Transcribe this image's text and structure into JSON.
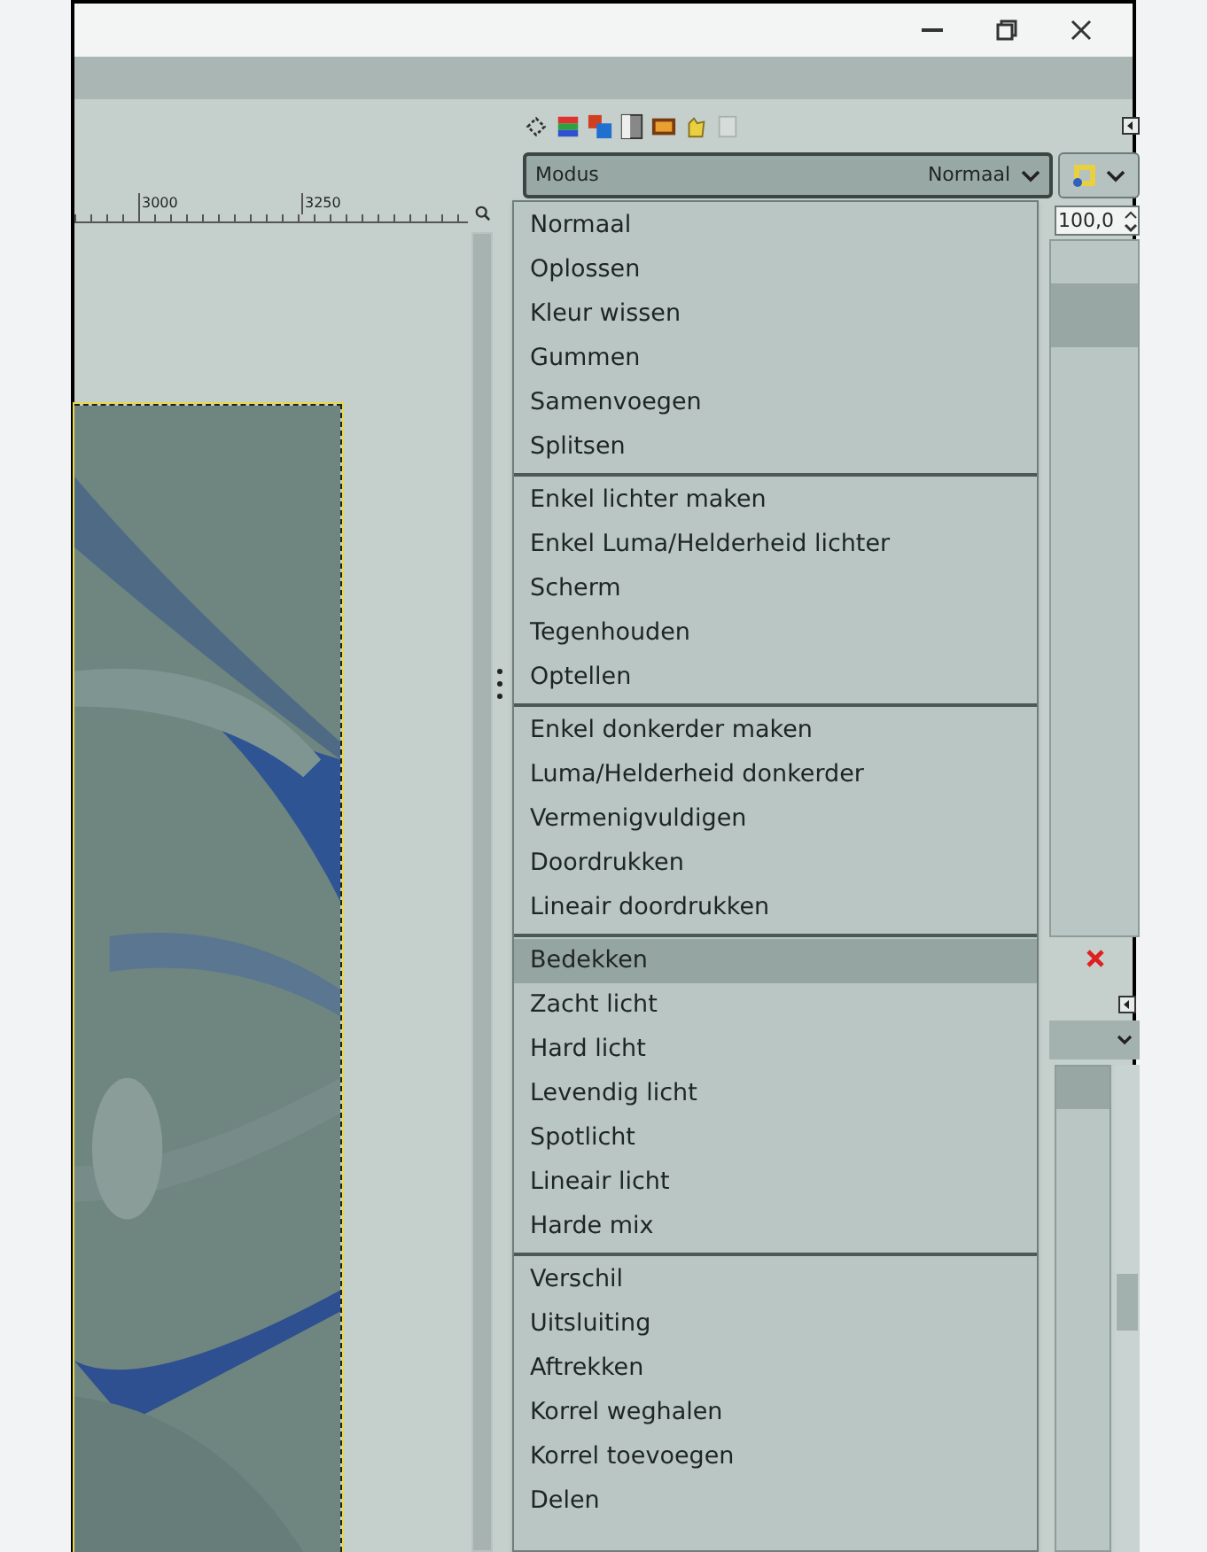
{
  "ruler": {
    "labels": [
      "3000",
      "3250"
    ]
  },
  "mode_select": {
    "label": "Modus",
    "value": "Normaal"
  },
  "opacity": {
    "value": "100,0"
  },
  "mode_menu": {
    "groups": [
      {
        "items": [
          {
            "label": "Normaal",
            "selected": false
          },
          {
            "label": "Oplossen",
            "selected": false
          },
          {
            "label": "Kleur wissen",
            "selected": false
          },
          {
            "label": "Gummen",
            "selected": false
          },
          {
            "label": "Samenvoegen",
            "selected": false
          },
          {
            "label": "Splitsen",
            "selected": false
          }
        ]
      },
      {
        "items": [
          {
            "label": "Enkel lichter maken",
            "selected": false
          },
          {
            "label": "Enkel Luma/Helderheid lichter",
            "selected": false
          },
          {
            "label": "Scherm",
            "selected": false
          },
          {
            "label": "Tegenhouden",
            "selected": false
          },
          {
            "label": "Optellen",
            "selected": false
          }
        ]
      },
      {
        "items": [
          {
            "label": "Enkel donkerder maken",
            "selected": false
          },
          {
            "label": "Luma/Helderheid donkerder",
            "selected": false
          },
          {
            "label": "Vermenigvuldigen",
            "selected": false
          },
          {
            "label": "Doordrukken",
            "selected": false
          },
          {
            "label": "Lineair doordrukken",
            "selected": false
          }
        ]
      },
      {
        "items": [
          {
            "label": "Bedekken",
            "selected": true
          },
          {
            "label": "Zacht licht",
            "selected": false
          },
          {
            "label": "Hard licht",
            "selected": false
          },
          {
            "label": "Levendig licht",
            "selected": false
          },
          {
            "label": "Spotlicht",
            "selected": false
          },
          {
            "label": "Lineair licht",
            "selected": false
          },
          {
            "label": "Harde mix",
            "selected": false
          }
        ]
      },
      {
        "items": [
          {
            "label": "Verschil",
            "selected": false
          },
          {
            "label": "Uitsluiting",
            "selected": false
          },
          {
            "label": "Aftrekken",
            "selected": false
          },
          {
            "label": "Korrel weghalen",
            "selected": false
          },
          {
            "label": "Korrel toevoegen",
            "selected": false
          },
          {
            "label": "Delen",
            "selected": false
          }
        ]
      }
    ]
  }
}
